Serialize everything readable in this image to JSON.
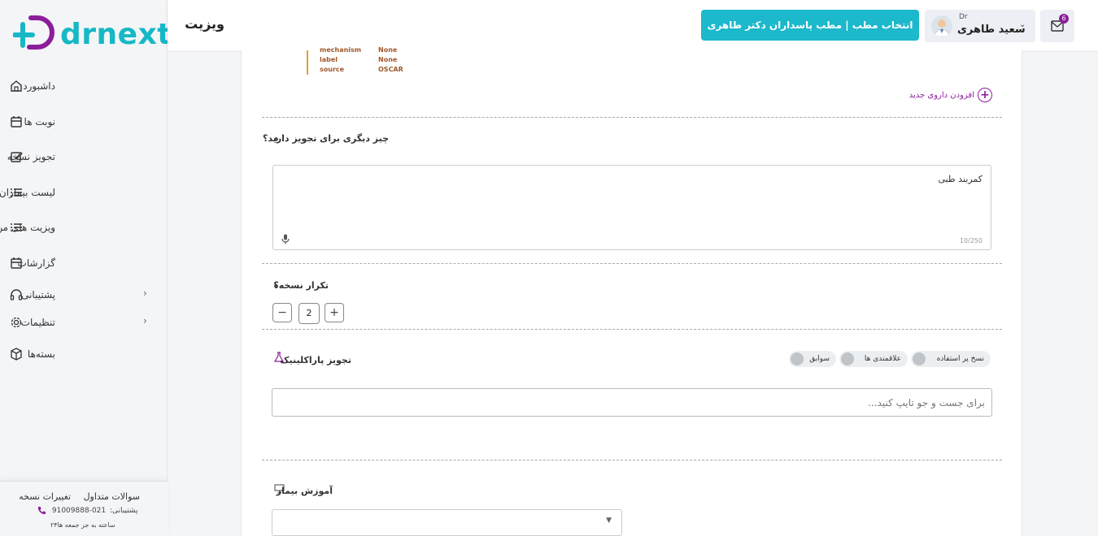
{
  "app": {
    "logo_text": "drnext"
  },
  "header": {
    "title": "ویزیت",
    "clinic_button": "انتخاب مطب | مطب پاسداران دکتر طاهری",
    "user_prefix": "Dr",
    "user_name": "سعید طاهری",
    "mail_badge": "6"
  },
  "sidebar": {
    "items": [
      {
        "label": "داشبورد",
        "icon": "home-icon"
      },
      {
        "label": "نوبت ها",
        "icon": "calendar-icon"
      },
      {
        "label": "تجویز نسخه",
        "icon": "edit-icon"
      },
      {
        "label": "لیست بیماران",
        "icon": "list-icon"
      },
      {
        "label": "ویزیت های من",
        "icon": "list-icon"
      },
      {
        "label": "گزارشات",
        "icon": "calendar-icon"
      },
      {
        "label": "پشتیبانی",
        "icon": "headset-icon"
      },
      {
        "label": "تنظیمات",
        "icon": "gear-icon"
      },
      {
        "label": "بسته‌ها",
        "icon": "box-icon"
      }
    ],
    "footer": {
      "faq": "سوالات متداول",
      "changes": "تغییرات نسخه",
      "support_label": "پشتیبانی:",
      "support_phone": "021-91009888",
      "hours": "۲۴ساعته به جز جمعه ها"
    }
  },
  "drug_info": {
    "rows": [
      {
        "key": "mechanism",
        "value": "None"
      },
      {
        "key": "label",
        "value": "None"
      },
      {
        "key": "source",
        "value": "OSCAR"
      }
    ]
  },
  "main": {
    "add_drug": "افزودن داروی جدید",
    "other_prescription_q": "چیز دیگری برای تجویز دارید؟",
    "other_prescription_value": "کمربند طبی",
    "char_counter": "10/250",
    "repeat_q": "تکرار نسخه؟",
    "repeat_value": "2",
    "paraclinic_title": "تجویز پاراکلینیک",
    "chips": [
      "نسخ پر استفاده",
      "علاقمندی ها",
      "سوابق"
    ],
    "search_placeholder": "برای جست و جو تایپ کنید...",
    "patient_education": "آموزش بیمار"
  }
}
